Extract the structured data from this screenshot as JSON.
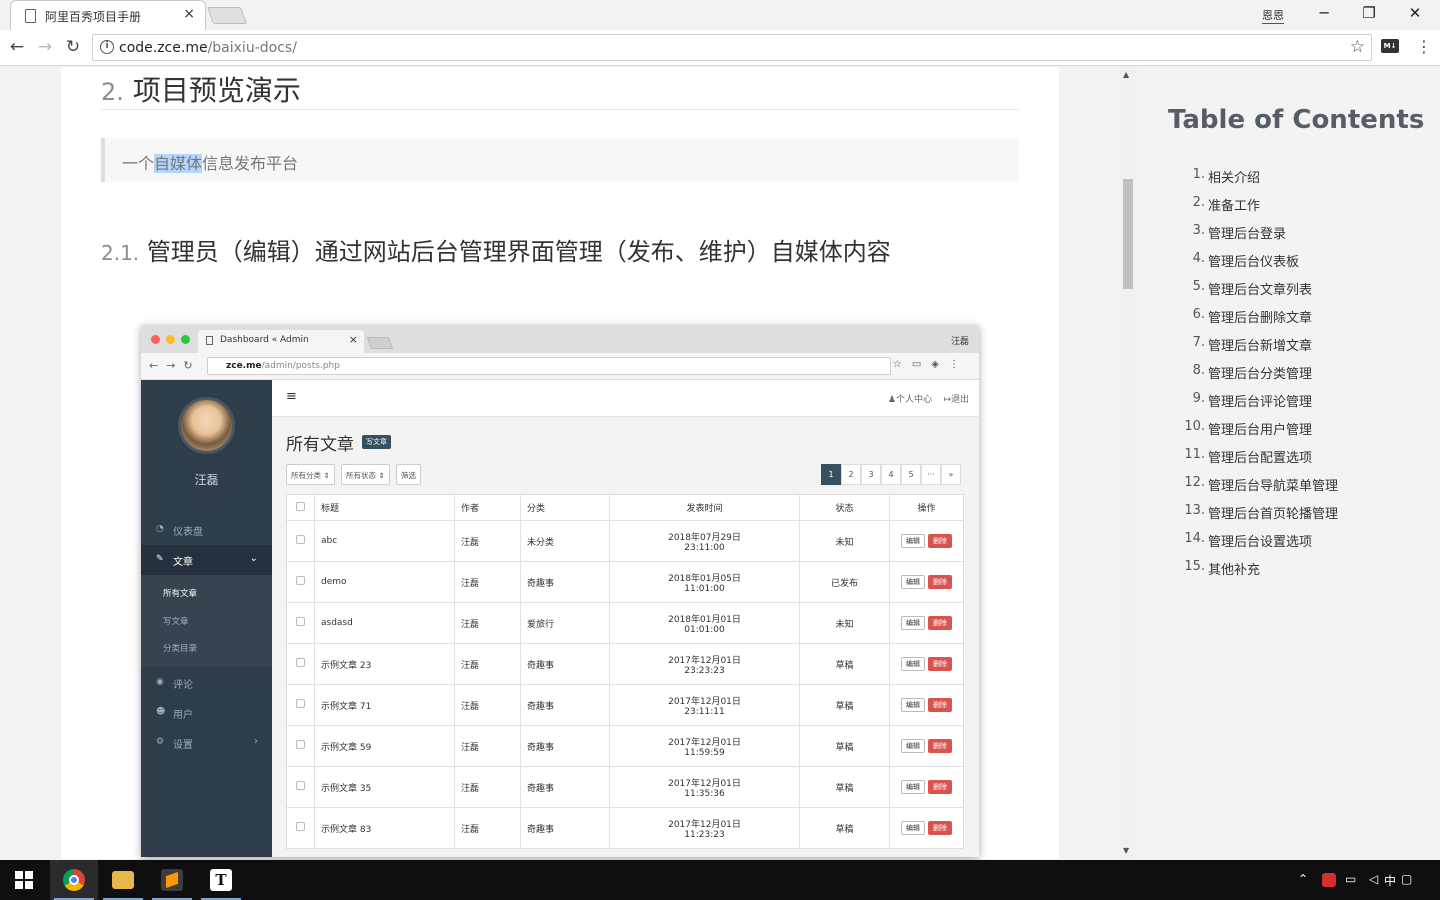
{
  "browser": {
    "tab_title": "阿里百秀项目手册",
    "tab_close": "×",
    "window_user": "恩恩",
    "url_host": "code.zce.me",
    "url_path": "/baixiu-docs/"
  },
  "article": {
    "section_num": "2.",
    "section_title": "项目预览演示",
    "quote_pre": "一个",
    "quote_highlight": "自媒体",
    "quote_post": "信息发布平台",
    "sub_num": "2.1.",
    "sub_title": "管理员（编辑）通过网站后台管理界面管理（发布、维护）自媒体内容"
  },
  "screenshot": {
    "tab_title": "Dashboard « Admin",
    "tab_close": "×",
    "user": "汪磊",
    "url_host": "zce.me",
    "url_path": "/admin/posts.php",
    "sidebar_name": "汪磊",
    "menu": {
      "dashboard": "仪表盘",
      "posts": "文章",
      "posts_all": "所有文章",
      "posts_new": "写文章",
      "posts_cats": "分类目录",
      "comments": "评论",
      "users": "用户",
      "settings": "设置"
    },
    "topbar_profile": "个人中心",
    "topbar_logout": "退出",
    "page_title": "所有文章",
    "badge": "写文章",
    "filter_category": "所有分类",
    "filter_status": "所有状态",
    "filter_btn": "筛选",
    "pager": [
      "1",
      "2",
      "3",
      "4",
      "5",
      "···",
      "»"
    ],
    "columns": [
      "标题",
      "作者",
      "分类",
      "发表时间",
      "状态",
      "操作"
    ],
    "edit_label": "编辑",
    "delete_label": "删除",
    "rows": [
      {
        "title": "abc",
        "author": "汪磊",
        "category": "未分类",
        "date": "2018年07月29日",
        "time": "23:11:00",
        "status": "未知"
      },
      {
        "title": "demo",
        "author": "汪磊",
        "category": "奇趣事",
        "date": "2018年01月05日",
        "time": "11:01:00",
        "status": "已发布"
      },
      {
        "title": "asdasd",
        "author": "汪磊",
        "category": "爱旅行",
        "date": "2018年01月01日",
        "time": "01:01:00",
        "status": "未知"
      },
      {
        "title": "示例文章 23",
        "author": "汪磊",
        "category": "奇趣事",
        "date": "2017年12月01日",
        "time": "23:23:23",
        "status": "草稿"
      },
      {
        "title": "示例文章 71",
        "author": "汪磊",
        "category": "奇趣事",
        "date": "2017年12月01日",
        "time": "23:11:11",
        "status": "草稿"
      },
      {
        "title": "示例文章 59",
        "author": "汪磊",
        "category": "奇趣事",
        "date": "2017年12月01日",
        "time": "11:59:59",
        "status": "草稿"
      },
      {
        "title": "示例文章 35",
        "author": "汪磊",
        "category": "奇趣事",
        "date": "2017年12月01日",
        "time": "11:35:36",
        "status": "草稿"
      },
      {
        "title": "示例文章 83",
        "author": "汪磊",
        "category": "奇趣事",
        "date": "2017年12月01日",
        "time": "11:23:23",
        "status": "草稿"
      }
    ]
  },
  "toc": {
    "title": "Table of Contents",
    "items": [
      {
        "n": "1.",
        "t": "相关介绍"
      },
      {
        "n": "2.",
        "t": "准备工作"
      },
      {
        "n": "3.",
        "t": "管理后台登录"
      },
      {
        "n": "4.",
        "t": "管理后台仪表板"
      },
      {
        "n": "5.",
        "t": "管理后台文章列表"
      },
      {
        "n": "6.",
        "t": "管理后台删除文章"
      },
      {
        "n": "7.",
        "t": "管理后台新增文章"
      },
      {
        "n": "8.",
        "t": "管理后台分类管理"
      },
      {
        "n": "9.",
        "t": "管理后台评论管理"
      },
      {
        "n": "10.",
        "t": "管理后台用户管理"
      },
      {
        "n": "11.",
        "t": "管理后台配置选项"
      },
      {
        "n": "12.",
        "t": "管理后台导航菜单管理"
      },
      {
        "n": "13.",
        "t": "管理后台首页轮播管理"
      },
      {
        "n": "14.",
        "t": "管理后台设置选项"
      },
      {
        "n": "15.",
        "t": "其他补充"
      }
    ]
  },
  "taskbar": {
    "ime": "中",
    "apps": [
      "chrome-icon",
      "file-explorer-icon",
      "sublime-text-icon",
      "typora-icon"
    ]
  },
  "colors": {
    "sidebar_bg": "#2f3c4a",
    "delete_red": "#d9534f",
    "toc_title": "#555e68",
    "selection": "#b4d5fe"
  }
}
